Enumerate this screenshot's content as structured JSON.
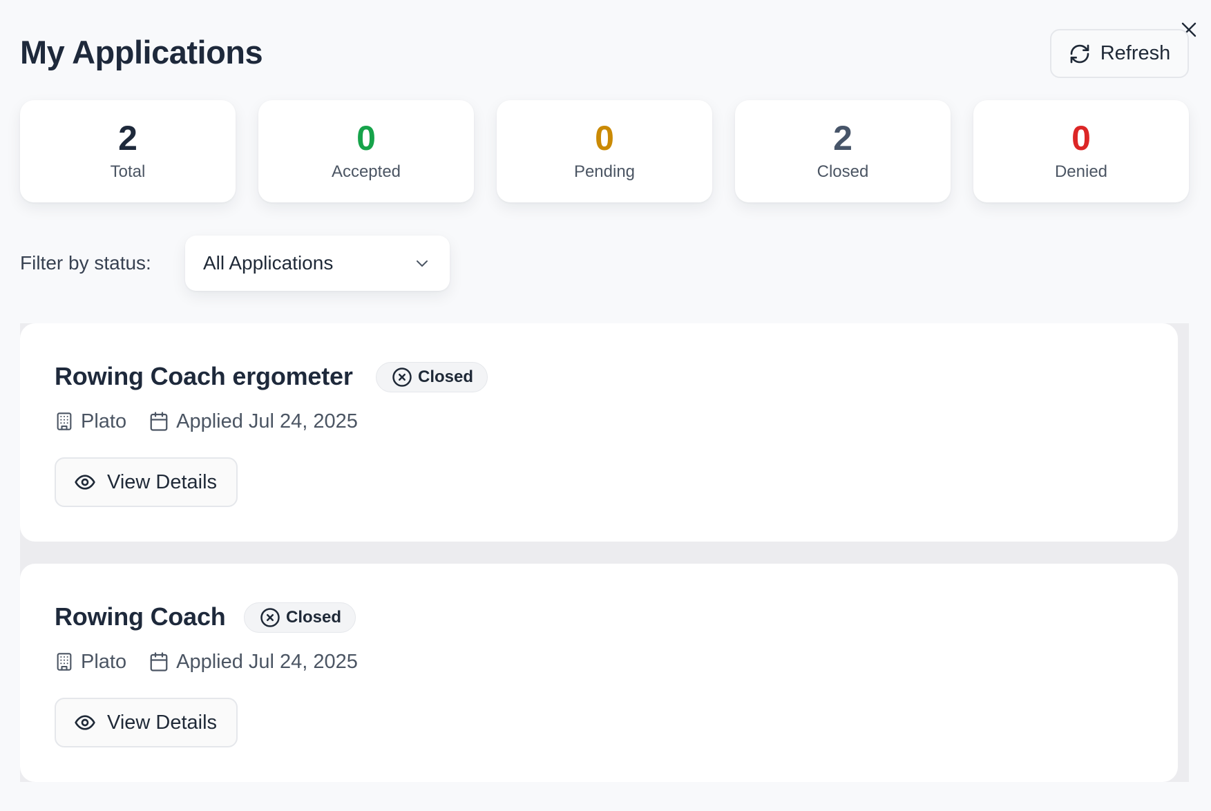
{
  "header": {
    "title": "My Applications",
    "refresh_label": "Refresh"
  },
  "stats": [
    {
      "value": "2",
      "label": "Total",
      "color": "#1e293b"
    },
    {
      "value": "0",
      "label": "Accepted",
      "color": "#16a34a"
    },
    {
      "value": "0",
      "label": "Pending",
      "color": "#ca8a04"
    },
    {
      "value": "2",
      "label": "Closed",
      "color": "#475569"
    },
    {
      "value": "0",
      "label": "Denied",
      "color": "#dc2626"
    }
  ],
  "filter": {
    "label": "Filter by status:",
    "selected": "All Applications"
  },
  "applications": [
    {
      "title": "Rowing Coach ergometer",
      "status": "Closed",
      "company": "Plato",
      "applied": "Applied Jul 24, 2025",
      "action_label": "View Details"
    },
    {
      "title": "Rowing Coach",
      "status": "Closed",
      "company": "Plato",
      "applied": "Applied Jul 24, 2025",
      "action_label": "View Details"
    }
  ],
  "icons": {
    "close": "close-icon",
    "refresh": "refresh-icon",
    "chevron": "chevron-down-icon",
    "status": "x-circle-icon",
    "company": "building-icon",
    "date": "calendar-icon",
    "view": "eye-icon"
  }
}
